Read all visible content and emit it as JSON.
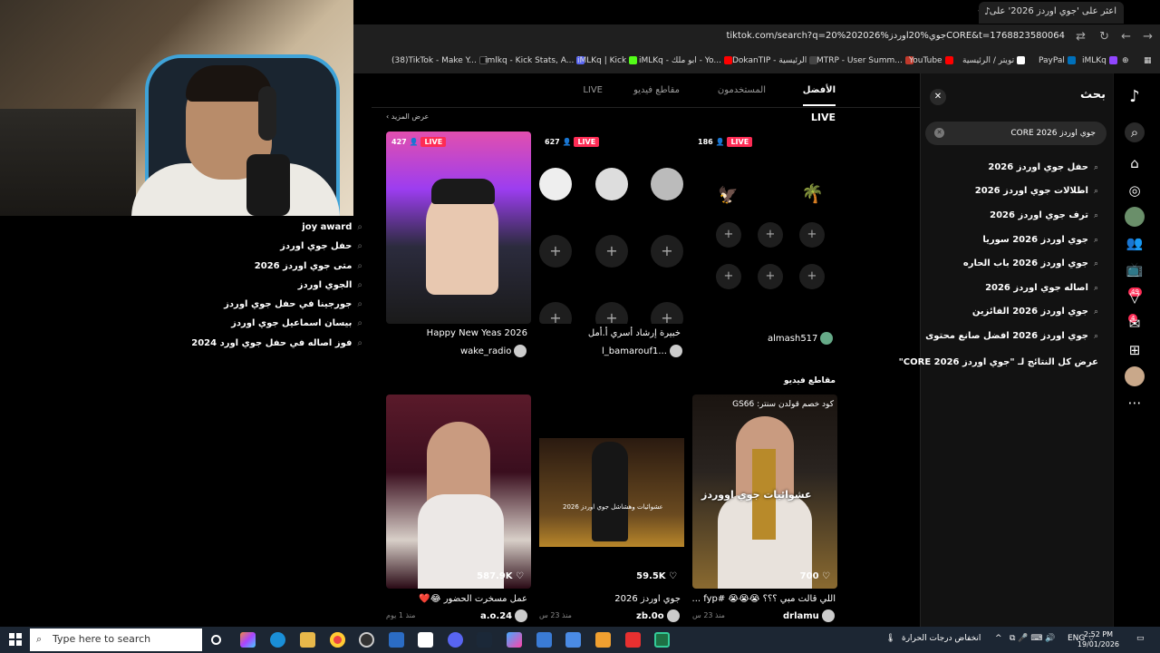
{
  "browser": {
    "tab_title": "اعثر على 'جوي اوردز 2026' على",
    "url": "tiktok.com/search?q=جوي%20اوردز%202026%20CORE&t=1768823580064",
    "bookmarks": [
      "(38)TikTok - Make Y...",
      "imlkq - Kick Stats, A...",
      "iMLKq | Kick",
      "iMLKq - ابو ملك - Yo...",
      "DokanTIP - الرئيسية",
      "MTRP - User Summ...",
      "YouTube",
      "تويتر / الرئيسية",
      "PayPal",
      "iMLKq"
    ]
  },
  "left_suggestions": [
    "joy award",
    "حفل جوي اوردز",
    "متى جوي اوردز 2026",
    "الجوي اوردز",
    "جورجينا في حفل جوي اوردز",
    "بيسان اسماعيل جوي اوردز",
    "فوز اصاله في حفل جوي اورد 2024"
  ],
  "search_panel": {
    "title": "بحث",
    "query": "جوي اوردز CORE 2026",
    "suggestions": [
      "حفل جوي اوردز 2026",
      "اطلالات جوي اوردز 2026",
      "ترف جوي اوردز 2026",
      "جوي اوردز 2026 سوريا",
      "جوي اوردز 2026 باب الحاره",
      "اصاله جوي اوردز 2026",
      "جوي اوردز 2026 الفائزين",
      "جوي اوردز 2026 افضل صانع محتوى"
    ],
    "view_all": "عرض كل النتائج لـ \"جوي اوردز CORE 2026\""
  },
  "nav": {
    "badge_inbox": "49",
    "badge_messages": "4"
  },
  "main": {
    "tabs": [
      "الأفضل",
      "المستخدمون",
      "مقاطع فيديو",
      "LIVE"
    ],
    "live_heading": "LIVE",
    "see_more": "عرض المزيد ›",
    "live_badge": "LIVE",
    "live_cards": [
      {
        "count": "427",
        "title": "Happy New Yeas 2026",
        "user": "wake_radio"
      },
      {
        "count": "627",
        "title": "خبيرة إرشاد أسري أ.أمل",
        "user": "l_bamarouf1..."
      },
      {
        "count": "186",
        "title": "",
        "user": "almash517"
      }
    ],
    "videos_heading": "مقاطع فيديو",
    "videos": [
      {
        "likes": "587.9K",
        "title": "عمل مسخرت الحضور 😂❤️",
        "user": "a.o.24",
        "date": "منذ 1 يوم"
      },
      {
        "likes": "59.5K",
        "title": "جوي اوردز 2026",
        "user": "zb.0o",
        "date": "منذ 23 س"
      },
      {
        "likes": "700",
        "title": "اللي قالت مبي ؟؟؟ 😭😭😭 #fyp ...",
        "user": "drlamu",
        "date": "منذ 23 س",
        "overlay": "كود خصم قولدن سنتر: GS66",
        "caption": "عشوائيات جوي اووردز"
      }
    ],
    "video2_caption": "عشوائيات وهشاشل جوي اوردز 2026"
  },
  "taskbar": {
    "search_placeholder": "Type here to search",
    "weather": "انخفاض درجات الحرارة",
    "lang": "ENG",
    "time": "2:52 PM",
    "date": "19/01/2026"
  }
}
